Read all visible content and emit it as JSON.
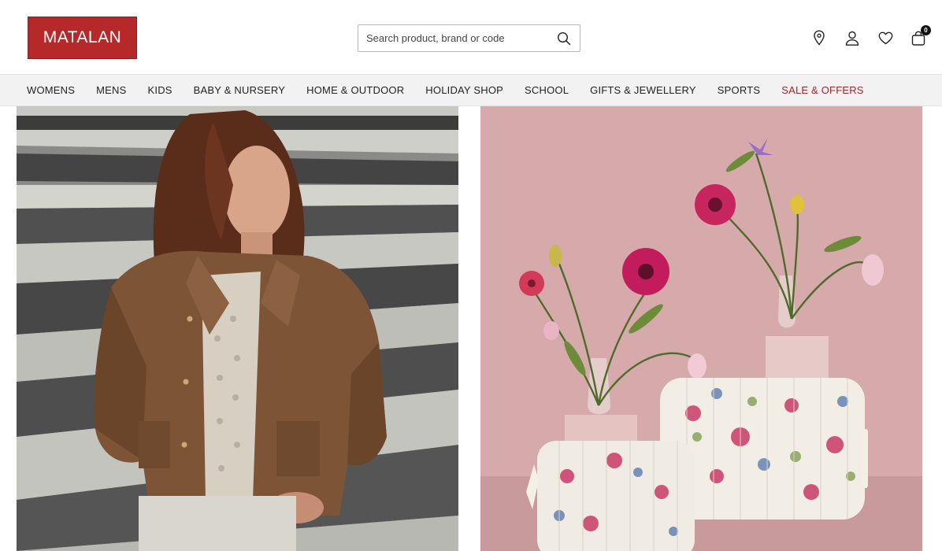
{
  "header": {
    "logo_text": "MATALAN",
    "search": {
      "placeholder": "Search product, brand or code",
      "value": ""
    },
    "basket_count": "0",
    "brand_color": "#b5292a"
  },
  "icons": {
    "search": "search-icon",
    "location": "location-pin-icon",
    "account": "user-icon",
    "wishlist": "heart-icon",
    "basket": "shopping-bag-icon"
  },
  "nav": {
    "items": [
      {
        "label": "WOMENS"
      },
      {
        "label": "MENS"
      },
      {
        "label": "KIDS"
      },
      {
        "label": "BABY & NURSERY"
      },
      {
        "label": "HOME & OUTDOOR"
      },
      {
        "label": "HOLIDAY SHOP"
      },
      {
        "label": "SCHOOL"
      },
      {
        "label": "GIFTS & JEWELLERY"
      },
      {
        "label": "SPORTS"
      },
      {
        "label": "SALE & OFFERS"
      }
    ],
    "sale_color": "#a42528"
  }
}
